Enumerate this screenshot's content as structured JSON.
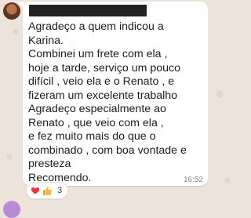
{
  "message": {
    "text": "Agradeço a quem indicou a\nKarina.\nCombinei um frete com ela ,\nhoje a tarde, serviço um pouco\ndifícil , veio ela e o Renato , e\nfizeram um excelente trabalho\nAgradeço especialmente ao\nRenato , que veio com ela ,\ne fez muito mais do que o\ncombinado , com boa vontade e\npresteza\nRecomendo.",
    "time": "16:52",
    "reactions": {
      "emojis": [
        "heart-icon",
        "thumbs-up-icon"
      ],
      "count": "3"
    }
  },
  "colors": {
    "background": "#ece4da",
    "bubble": "#ffffff",
    "text": "#1c1c1c",
    "timestamp": "#8a8a8a",
    "heart": "#e8363f",
    "thumbs_up": "#f5b73b"
  }
}
